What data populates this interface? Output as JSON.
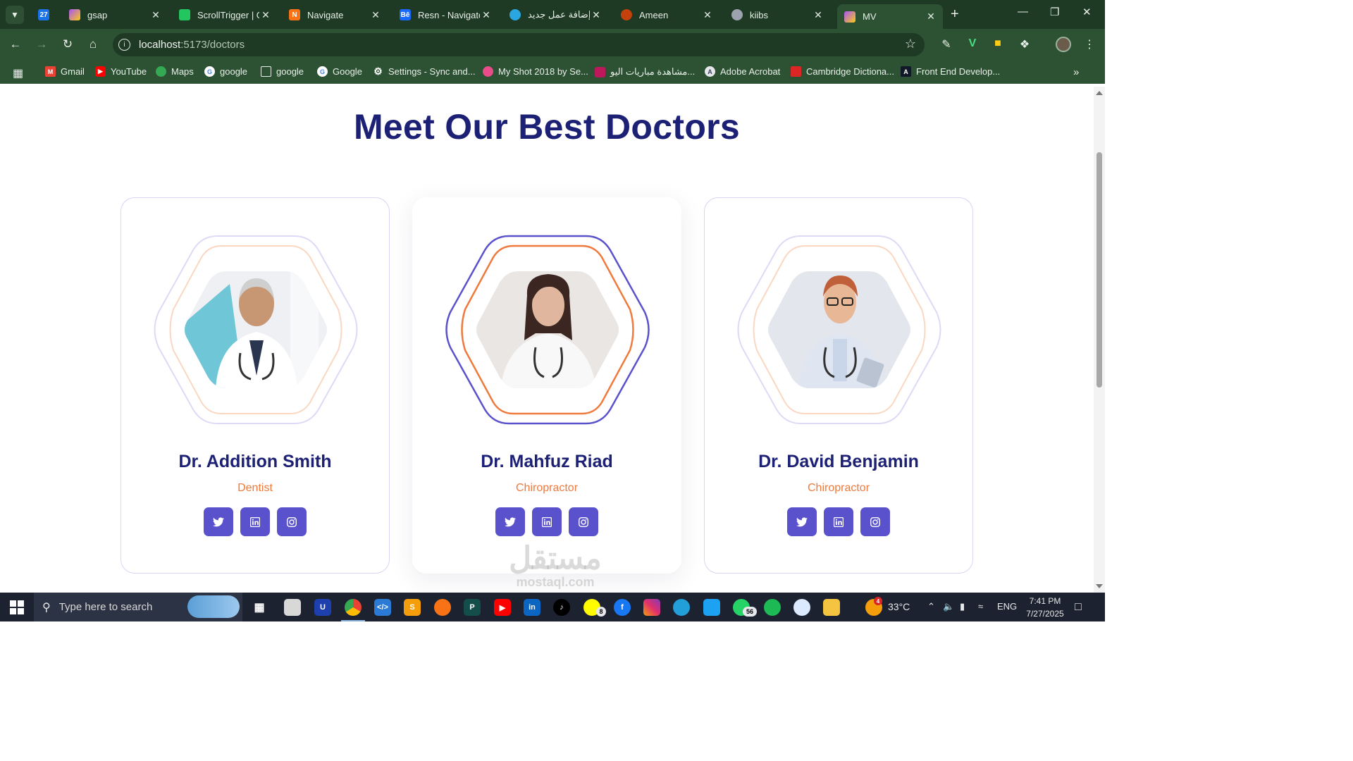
{
  "browser": {
    "tabs": [
      {
        "title": "",
        "icon": "calendar-icon",
        "color": "#1a73e8"
      },
      {
        "title": "gsap",
        "icon": "vite-icon",
        "color": "#a855f7"
      },
      {
        "title": "ScrollTrigger | G",
        "icon": "gsap-icon",
        "color": "#22c55e"
      },
      {
        "title": "Navigate",
        "icon": "navigate-icon",
        "color": "#f97316"
      },
      {
        "title": "Resn - Navigatc",
        "icon": "behance-icon",
        "color": "#1769ff"
      },
      {
        "title": "إضافة عمل جديد",
        "icon": "mostaql-icon",
        "color": "#2aa7e0"
      },
      {
        "title": "Ameen",
        "icon": "figure-icon",
        "color": "#c2410c"
      },
      {
        "title": "kiibs",
        "icon": "globe-icon",
        "color": "#9ca3af"
      },
      {
        "title": "MV",
        "icon": "vite-icon",
        "color": "#a855f7"
      }
    ],
    "url_host": "localhost",
    "url_path": ":5173/doctors",
    "bookmarks": [
      {
        "label": "Gmail",
        "icon": "gmail-icon",
        "color": "#ea4335"
      },
      {
        "label": "YouTube",
        "icon": "youtube-icon",
        "color": "#ff0000"
      },
      {
        "label": "Maps",
        "icon": "maps-icon",
        "color": "#34a853"
      },
      {
        "label": "google",
        "icon": "google-icon",
        "color": "#4285f4"
      },
      {
        "label": "google",
        "icon": "folder-icon",
        "color": "#2c5233"
      },
      {
        "label": "Google",
        "icon": "google-icon",
        "color": "#4285f4"
      },
      {
        "label": "Settings - Sync and...",
        "icon": "gear-icon",
        "color": "#6b7280"
      },
      {
        "label": "My Shot 2018 by Se...",
        "icon": "dribbble-icon",
        "color": "#ea4c89"
      },
      {
        "label": "مشاهدة مباريات اليو...",
        "icon": "shield-icon",
        "color": "#be185d"
      },
      {
        "label": "Adobe Acrobat",
        "icon": "acrobat-icon",
        "color": "#374151"
      },
      {
        "label": "Cambridge Dictiona...",
        "icon": "cambridge-icon",
        "color": "#dc2626"
      },
      {
        "label": "Front End Develop...",
        "icon": "fem-icon",
        "color": "#111827"
      }
    ]
  },
  "page": {
    "heading": "Meet Our Best Doctors",
    "doctors": [
      {
        "name": "Dr. Addition Smith",
        "role": "Dentist",
        "featured": false
      },
      {
        "name": "Dr. Mahfuz Riad",
        "role": "Chiropractor",
        "featured": true
      },
      {
        "name": "Dr. David Benjamin",
        "role": "Chiropractor",
        "featured": false
      }
    ],
    "social_icons": [
      "twitter-icon",
      "linkedin-icon",
      "instagram-icon"
    ],
    "colors": {
      "heading": "#1d2175",
      "role": "#ef7a3c",
      "social_bg": "#5a52cc",
      "hex_outer": "#5a52cc",
      "hex_inner": "#ef7a3c"
    }
  },
  "watermark": {
    "arabic": "مستقل",
    "latin": "mostaql.com"
  },
  "taskbar": {
    "search_placeholder": "Type here to search",
    "weather": "33°C",
    "language": "ENG",
    "time": "7:41 PM",
    "date": "7/27/2025",
    "badges": {
      "snapchat": "8",
      "whatsapp": "56",
      "weather": "4"
    }
  }
}
